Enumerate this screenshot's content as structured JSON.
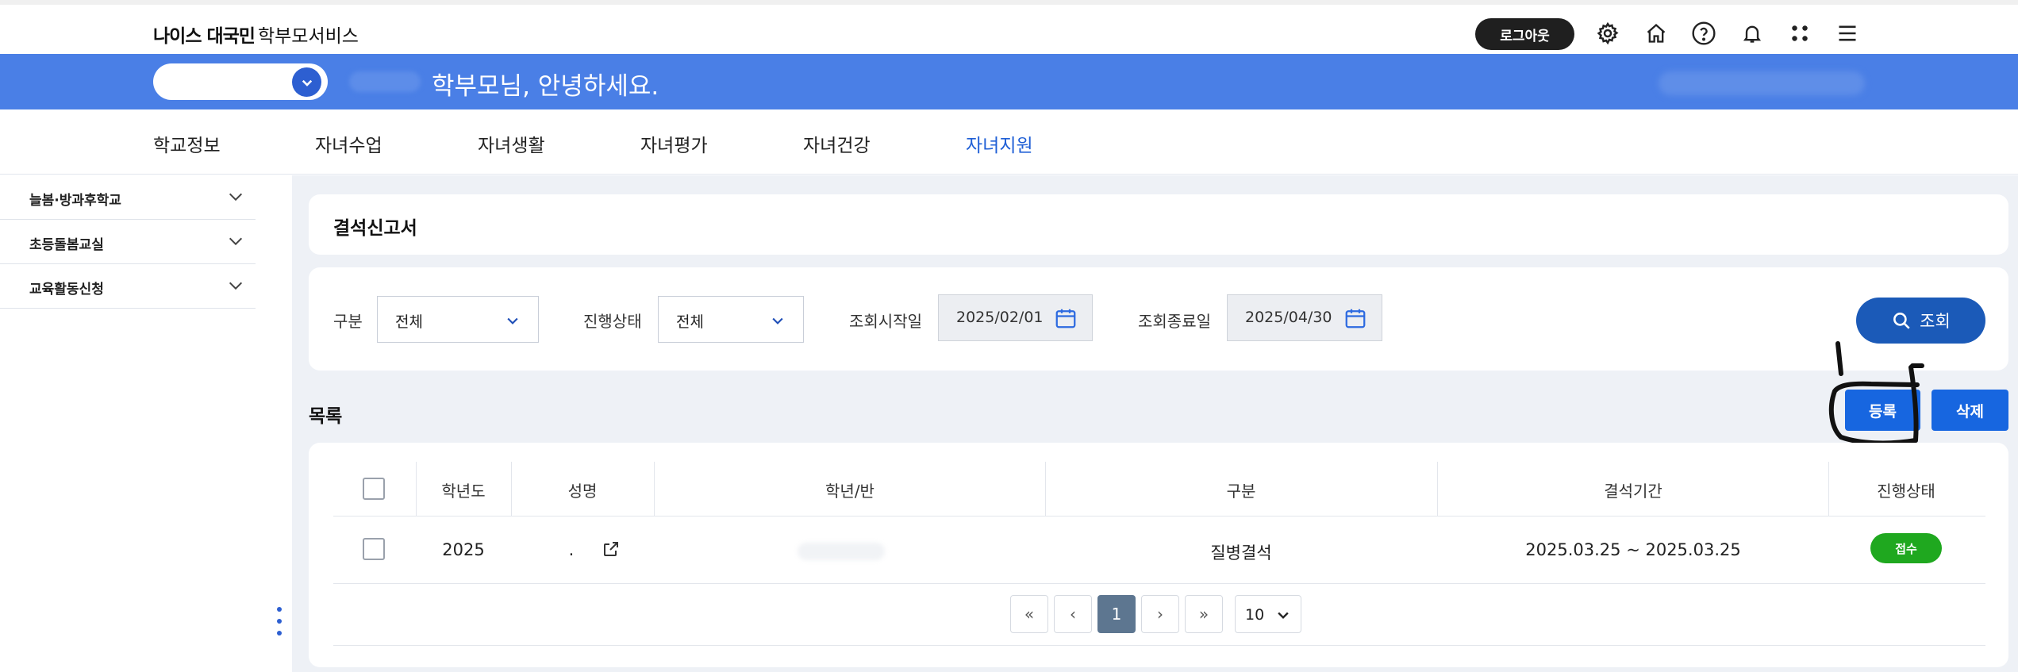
{
  "header": {
    "brand_bold": "나이스 대국민",
    "brand_rest": "학부모서비스",
    "logout_label": "로그아웃",
    "icons": [
      "gear-icon",
      "home-icon",
      "help-icon",
      "bell-icon",
      "apps-icon",
      "menu-icon"
    ]
  },
  "banner": {
    "greeting": "학부모님, 안녕하세요."
  },
  "nav": {
    "items": [
      "학교정보",
      "자녀수업",
      "자녀생활",
      "자녀평가",
      "자녀건강",
      "자녀지원"
    ],
    "active": "자녀지원",
    "active_color": "#1f5fd6"
  },
  "sidebar": {
    "items": [
      "늘봄·방과후학교",
      "초등돌봄교실",
      "교육활동신청"
    ]
  },
  "page": {
    "title": "결석신고서"
  },
  "filters": {
    "type_label": "구분",
    "type_value": "전체",
    "status_label": "진행상태",
    "status_value": "전체",
    "start_label": "조회시작일",
    "start_value": "2025/02/01",
    "end_label": "조회종료일",
    "end_value": "2025/04/30",
    "search_label": "조회"
  },
  "list": {
    "title": "목록",
    "register_label": "등록",
    "delete_label": "삭제",
    "columns": [
      "학년도",
      "성명",
      "학년/반",
      "구분",
      "결석기간",
      "진행상태"
    ],
    "rows": [
      {
        "year": "2025",
        "name": ".",
        "class": "",
        "type": "질병결석",
        "period": "2025.03.25 ~ 2025.03.25",
        "status": "접수"
      }
    ]
  },
  "pagination": {
    "first": "«",
    "prev": "‹",
    "current": "1",
    "next": "›",
    "last": "»",
    "page_size": "10"
  },
  "colors": {
    "banner": "#4a7fe6",
    "primary_button": "#1766e0",
    "search_button": "#1b5ab8",
    "status_badge": "#1fa81f"
  }
}
